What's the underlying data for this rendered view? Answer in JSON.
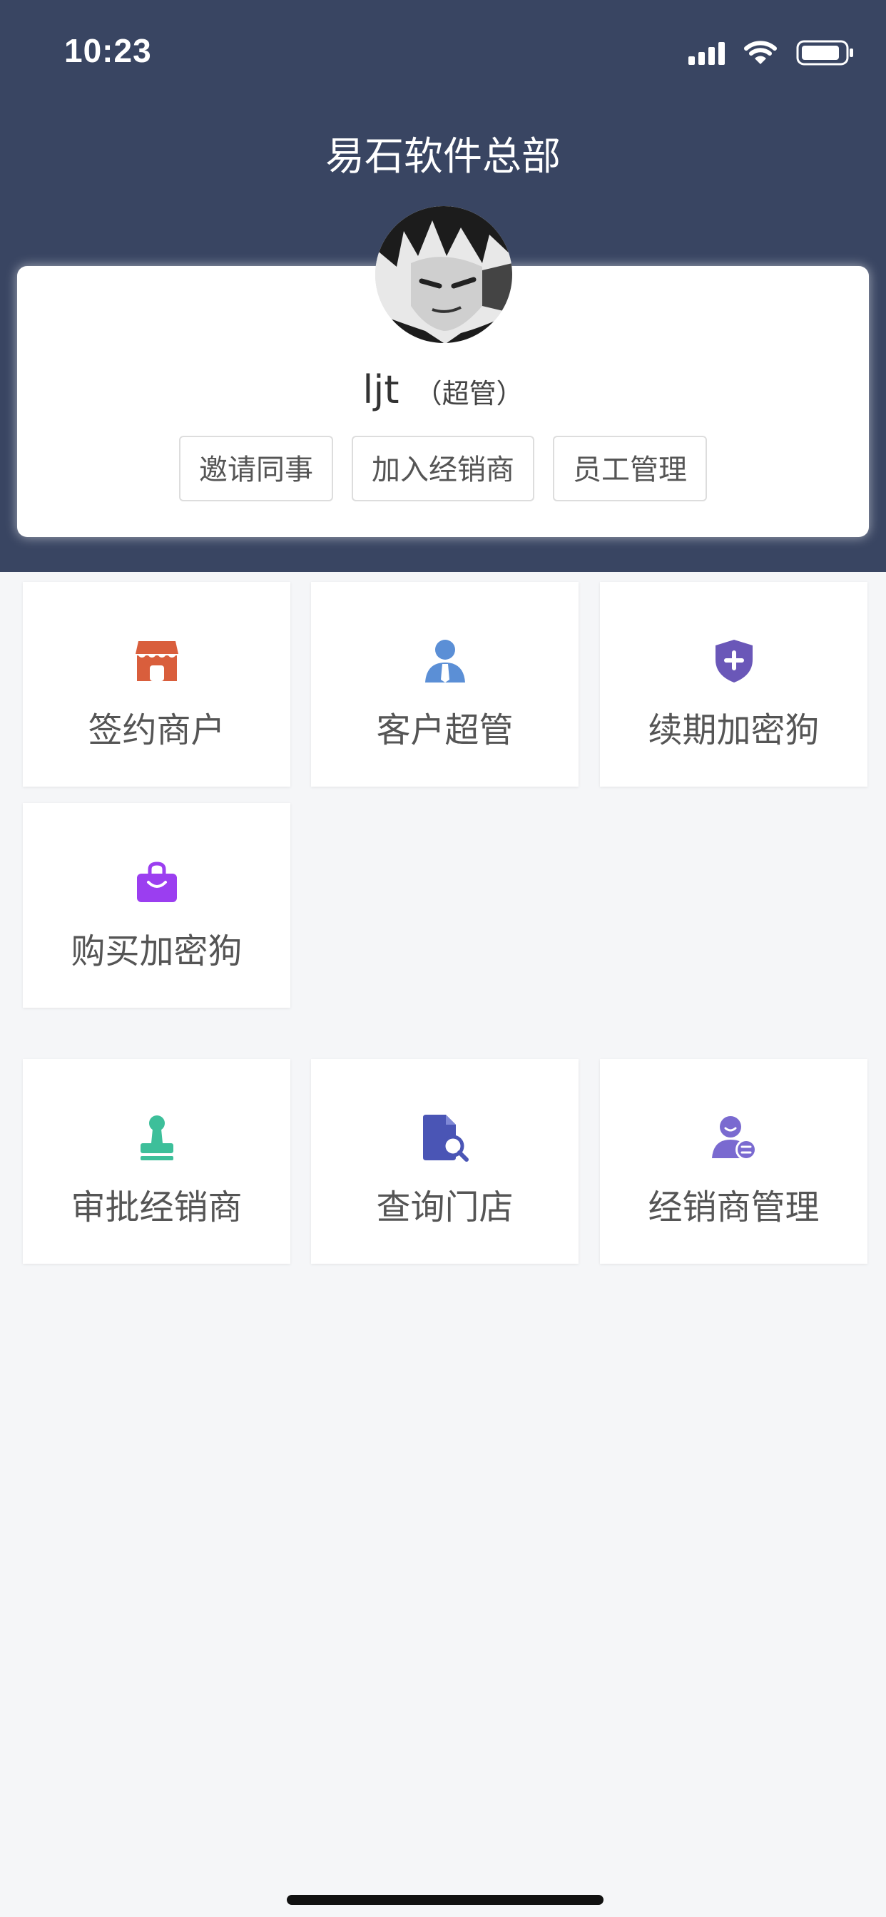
{
  "status_bar": {
    "time": "10:23"
  },
  "header": {
    "title": "易石软件总部"
  },
  "profile": {
    "name": "ljt",
    "role": "（超管）",
    "actions": [
      "邀请同事",
      "加入经销商",
      "员工管理"
    ]
  },
  "tiles": {
    "sign_merchant": {
      "label": "签约商户",
      "icon": "store-icon",
      "color": "#d95e3c"
    },
    "customer_admin": {
      "label": "客户超管",
      "icon": "user-tie-icon",
      "color": "#5b8fd6"
    },
    "renew_dongle": {
      "label": "续期加密狗",
      "icon": "shield-plus-icon",
      "color": "#6a57b8"
    },
    "buy_dongle": {
      "label": "购买加密狗",
      "icon": "shopping-bag-icon",
      "color": "#9b3ef0"
    },
    "approve_dealer": {
      "label": "审批经销商",
      "icon": "stamp-icon",
      "color": "#3dbf9a"
    },
    "query_store": {
      "label": "查询门店",
      "icon": "document-search-icon",
      "color": "#4a55b5"
    },
    "dealer_manage": {
      "label": "经销商管理",
      "icon": "user-list-icon",
      "color": "#7a6ad0"
    }
  }
}
